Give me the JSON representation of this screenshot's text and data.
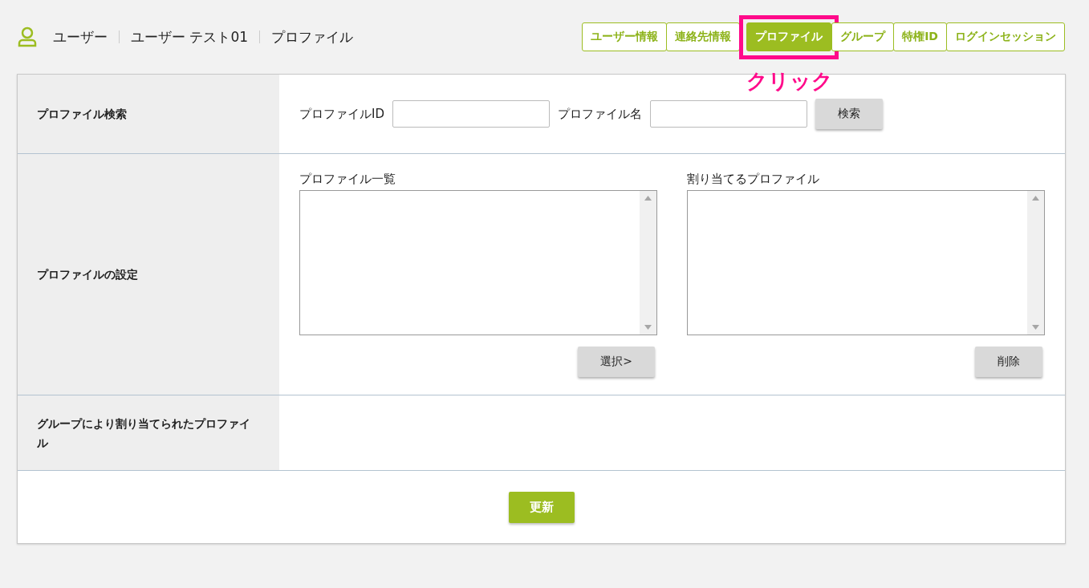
{
  "breadcrumb": [
    "ユーザー",
    "ユーザー テスト01",
    "プロファイル"
  ],
  "tabs": [
    {
      "label": "ユーザー情報",
      "selected": false
    },
    {
      "label": "連絡先情報",
      "selected": false
    },
    {
      "label": "プロファイル",
      "selected": true,
      "annotation": "クリック"
    },
    {
      "label": "グループ",
      "selected": false
    },
    {
      "label": "特権ID",
      "selected": false
    },
    {
      "label": "ログインセッション",
      "selected": false
    }
  ],
  "sections": [
    {
      "kind": "search",
      "label": "プロファイル検索",
      "fields": [
        {
          "label": "プロファイルID"
        },
        {
          "label": "プロファイル名"
        }
      ],
      "button": "検索"
    },
    {
      "kind": "dual-list",
      "label": "プロファイルの設定",
      "lists": [
        {
          "label": "プロファイル一覧",
          "button": "選択>"
        },
        {
          "label": "割り当てるプロファイル",
          "button": "削除"
        }
      ]
    },
    {
      "kind": "empty",
      "label": "グループにより割り当てられたプロファイル"
    }
  ],
  "submit_button": "更新"
}
